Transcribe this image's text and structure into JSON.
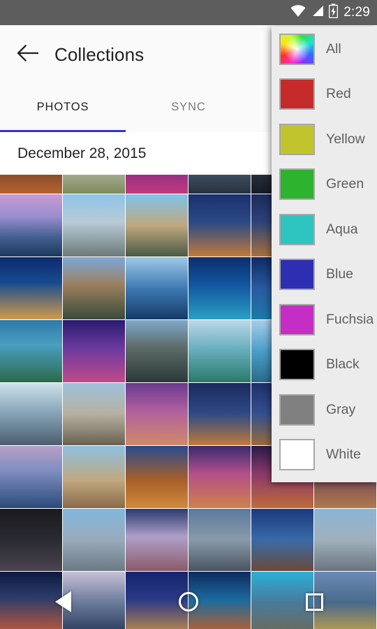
{
  "status_bar": {
    "time": "2:29",
    "icons": [
      "wifi-icon",
      "signal-icon",
      "battery-charging-icon"
    ],
    "background": "#5d5d5d"
  },
  "app_bar": {
    "back_icon": "back-arrow-icon",
    "title": "Collections",
    "background": "#fafafa"
  },
  "tabs": {
    "items": [
      {
        "label": "PHOTOS",
        "active": true
      },
      {
        "label": "SYNC",
        "active": false
      }
    ],
    "indicator_color": "#3333cc"
  },
  "content": {
    "date_header": "December 28, 2015"
  },
  "color_menu": {
    "background": "#ececec",
    "items": [
      {
        "label": "All",
        "swatch": "rainbow-gradient"
      },
      {
        "label": "Red",
        "swatch": "#c62b2b"
      },
      {
        "label": "Yellow",
        "swatch": "#c2c42e"
      },
      {
        "label": "Green",
        "swatch": "#2eb32e"
      },
      {
        "label": "Aqua",
        "swatch": "#2ec4c0"
      },
      {
        "label": "Blue",
        "swatch": "#2e2eb3"
      },
      {
        "label": "Fuchsia",
        "swatch": "#c42ec4"
      },
      {
        "label": "Black",
        "swatch": "#000000"
      },
      {
        "label": "Gray",
        "swatch": "#808080"
      },
      {
        "label": "White",
        "swatch": "#ffffff"
      }
    ]
  },
  "nav_bar": {
    "back_label": "back-triangle-icon",
    "home_label": "home-circle-icon",
    "recents_label": "recents-square-icon"
  },
  "photo_grid": {
    "columns": 6,
    "cell_size": 89,
    "tiles": [
      "linear-gradient(180deg,#2a1a22 0%,#6b3a28 45%,#b5632f 100%)",
      "linear-gradient(180deg,#dcdcd6 0%,#bdbdb2 50%,#7d8a5a 100%)",
      "linear-gradient(180deg,#2b1038 0%,#7d2a8c 50%,#c23a7a 100%)",
      "linear-gradient(180deg,#6a7c8e 0%,#44566a 60%,#27323e 100%)",
      "linear-gradient(180deg,#3f4a5c 0%,#2a3340 60%,#161c24 100%)",
      "linear-gradient(180deg,#33404e 0%,#1f2731 60%,#121820 100%)",
      "linear-gradient(180deg,#c89ad6 0%,#9b8fd0 35%,#3f5e8e 70%,#1c3a5e 100%)",
      "linear-gradient(180deg,#8fc4e8 0%,#b7cad6 45%,#6e7a78 100%)",
      "linear-gradient(180deg,#7fc3e8 0%,#bfa87e 50%,#4a5a46 100%)",
      "linear-gradient(180deg,#1b2f6e 0%,#2a4a86 45%,#c27a3a 100%)",
      "linear-gradient(180deg,#1d2a5c 0%,#2d4478 45%,#a8703c 100%)",
      "linear-gradient(180deg,#24356a 0%,#37508a 50%,#8a6a3c 100%)",
      "linear-gradient(180deg,#0e2a6e 0%,#164a8e 40%,#d19a4a 100%)",
      "linear-gradient(180deg,#7fa8d6 0%,#9a7f5e 45%,#3a4a3a 100%)",
      "linear-gradient(180deg,#9ec8e6 0%,#3f7ab4 50%,#143a66 100%)",
      "linear-gradient(180deg,#0b2f6e 0%,#1256a0 45%,#2aa0c4 100%)",
      "linear-gradient(180deg,#0e2a66 0%,#2a5aa0 50%,#1a7aa8 100%)",
      "linear-gradient(180deg,#132d5e 0%,#2f5c9a 50%,#d0943c 100%)",
      "linear-gradient(180deg,#2f7aa8 0%,#4a9ec0 40%,#2a6a4a 100%)",
      "linear-gradient(180deg,#2a1a6e 0%,#6a3a9e 45%,#c04a8a 100%)",
      "linear-gradient(180deg,#7fa8c8 0%,#5c6a66 45%,#2a3a3a 100%)",
      "linear-gradient(180deg,#bcd8ea 0%,#6ab0c0 45%,#2a7a6a 100%)",
      "linear-gradient(180deg,#a8cde8 0%,#4a9ec8 50%,#2a6a8a 100%)",
      "linear-gradient(180deg,#9ec4de 0%,#4f8ab0 50%,#2f5a70 100%)",
      "linear-gradient(180deg,#cfe2ea 0%,#8aa8bc 45%,#4a5e6e 100%)",
      "linear-gradient(180deg,#9ec2dc 0%,#b6b0a0 50%,#6a6050 100%)",
      "linear-gradient(180deg,#6a3a8e 0%,#b0609e 45%,#d08a6a 100%)",
      "linear-gradient(180deg,#1a2a5e 0%,#2f4a86 50%,#c07a3a 100%)",
      "linear-gradient(180deg,#1e2f6a 0%,#35508e 50%,#9a6a3a 100%)",
      "linear-gradient(180deg,#243a72 0%,#3a5a9a 50%,#8a7a4a 100%)",
      "linear-gradient(180deg,#b8a0c8 0%,#7f8ec0 40%,#2a4a7a 100%)",
      "linear-gradient(180deg,#8ec0e0 0%,#c0a880 55%,#8a6a4a 100%)",
      "linear-gradient(180deg,#2a4a8e 0%,#a8602a 55%,#d08a3a 100%)",
      "linear-gradient(180deg,#3a2a6e 0%,#b4508a 45%,#d0804a 100%)",
      "linear-gradient(180deg,#2a1a4a 0%,#8a3a6a 45%,#c06a3a 100%)",
      "linear-gradient(180deg,#2f3a6e 0%,#7a4a5a 50%,#b07a4a 100%)",
      "linear-gradient(180deg,#1a1a1e 0%,#2a2a32 50%,#4a4450 100%)",
      "linear-gradient(180deg,#7fb8dc 0%,#9aaabc 50%,#6a7a84 100%)",
      "linear-gradient(180deg,#2a3a6e 0%,#b0a0c8 45%,#8a5a6a 100%)",
      "linear-gradient(180deg,#5a7a9e 0%,#8a9aaa 50%,#4a5460 100%)",
      "linear-gradient(180deg,#1a3a7e 0%,#3a6aa8 50%,#6a4a3a 100%)",
      "linear-gradient(180deg,#8ab4d6 0%,#a0b0bc 50%,#6a7480 100%)",
      "linear-gradient(180deg,#0e1a3e 0%,#2a3a6a 40%,#c05a3a 100%)",
      "linear-gradient(180deg,#c8c0d8 0%,#6a7a9a 50%,#2a3a5a 100%)",
      "linear-gradient(180deg,#14246e 0%,#2a3a86 45%,#c08a4a 100%)",
      "linear-gradient(180deg,#0e2a5e 0%,#1a6a9e 45%,#c0602a 100%)",
      "linear-gradient(180deg,#2ab0d8 0%,#4a7a9a 50%,#6a6a5a 100%)",
      "linear-gradient(180deg,#6a8ab4 0%,#4a6a8a 50%,#c0a04a 100%)"
    ]
  }
}
